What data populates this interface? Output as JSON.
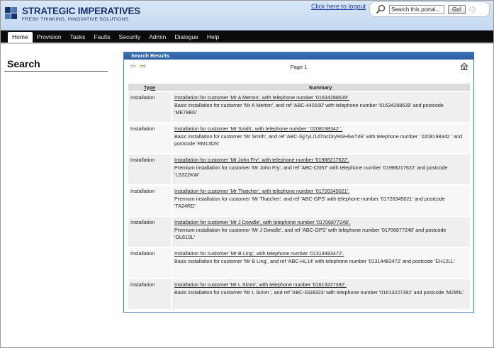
{
  "header": {
    "logo_title": "STRATEGIC IMPERATIVES",
    "logo_tagline": "FRESH THINKING, INNOVATIVE SOLUTIONS",
    "logout_link": "Click here to logout",
    "search": {
      "placeholder": "Search this portal...",
      "value": "Search this portal...",
      "go_label": "Go!"
    }
  },
  "nav": {
    "items": [
      "Home",
      "Provision",
      "Tasks",
      "Faults",
      "Security",
      "Admin",
      "Dialogue",
      "Help"
    ],
    "active": "Home"
  },
  "page": {
    "title": "Search"
  },
  "results": {
    "panel_title": "Search Results",
    "page_label": "Page 1",
    "columns": {
      "type": "Type",
      "summary": "Summary"
    },
    "rows": [
      {
        "type": "Installation",
        "link": "Installation for customer 'Mr  A Merton', with telephone number '01634288639'.",
        "detail": "Basic installation for customer 'Mr  A Merton', and ref 'ABC-440160' with telephone number '01634288639' and postcode 'ME78BG'"
      },
      {
        "type": "Installation",
        "link": "Installation for customer 'Mr Smith', with telephone number ' 0208198342 '.",
        "detail": "Basic installation for customer 'Mr Smith', and ref 'ABC-Sjj7yL/1ATncDryRGH6wT4E' with telephone number ' 0208198342 ' and postcode 'RM13DN'"
      },
      {
        "type": "Installation",
        "link": "Installation for customer 'Mr John Fry', with telephone number '01988217622'.",
        "detail": "Premium installation for customer 'Mr John Fry', and ref 'ABC-Cl057' with telephone number '01988217622' and postcode 'LS322KW'"
      },
      {
        "type": "Installation",
        "link": "Installation for customer 'Mr Thatcher', with telephone number '01726349021'.",
        "detail": "Premium installation for customer 'Mr Thatcher', and ref 'ABC-GPS' with telephone number '01726349021' and postcode 'TA24RD'"
      },
      {
        "type": "Installation",
        "link": "Installation for customer 'Mr J Dowdle', with telephone number '01706877248'.",
        "detail": "Premium installation for customer 'Mr J Dowdle', and ref 'ABC-GPS' with telephone number '01706877248' and postcode 'OL61SL'"
      },
      {
        "type": "Installation",
        "link": "Installation for customer 'Mr B Ling', with telephone number '01314483472'.",
        "detail": "Basic installation for customer 'Mr B Ling', and ref 'ABC-HL14' with telephone number '01314483472' and postcode 'EH12LL'"
      },
      {
        "type": "Installation",
        "link": "Installation for customer 'Mr L Simm', with telephone number '01613227392'.",
        "detail": "Basic installation for customer 'Mr L Simm ', and ref 'ABC-GG8323' with telephone number '01613227392' and postcode 'M29NL'"
      }
    ]
  },
  "colors": {
    "header_bg": "#c9dcf2",
    "nav_bg": "#0b0b0b",
    "brand_blue": "#17326a",
    "panel_header": "#2f64a8",
    "next_arrow": "#5a9a2e"
  },
  "icons": {
    "search": "magnifier-icon",
    "spinner": "loading-spinner-icon",
    "prev": "prev-arrow-icon",
    "next": "next-arrow-icon",
    "home": "home-icon"
  }
}
